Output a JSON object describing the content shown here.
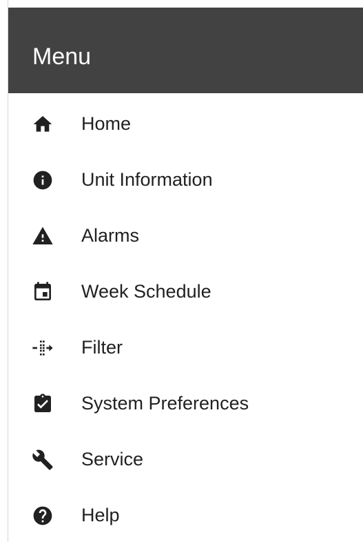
{
  "drawer": {
    "title": "Menu"
  },
  "menu": {
    "items": [
      {
        "label": "Home",
        "icon": "home-icon"
      },
      {
        "label": "Unit Information",
        "icon": "info-icon"
      },
      {
        "label": "Alarms",
        "icon": "warning-icon"
      },
      {
        "label": "Week Schedule",
        "icon": "calendar-icon"
      },
      {
        "label": "Filter",
        "icon": "filter-icon"
      },
      {
        "label": "System Preferences",
        "icon": "clipboard-check-icon"
      },
      {
        "label": "Service",
        "icon": "wrench-icon"
      },
      {
        "label": "Help",
        "icon": "help-icon"
      }
    ]
  },
  "colors": {
    "header_background": "#424242",
    "header_text": "#ffffff",
    "item_text": "#212121",
    "drawer_background": "#ffffff"
  }
}
